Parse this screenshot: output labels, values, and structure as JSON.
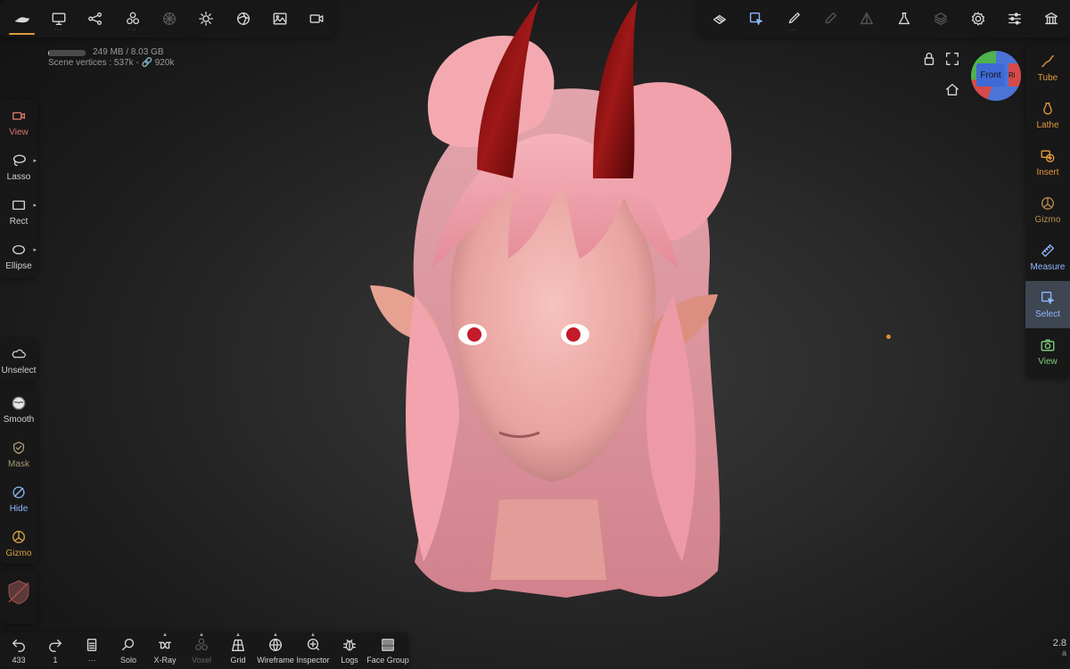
{
  "top_left_toolbar": {
    "items": [
      {
        "name": "nomad-menu-icon",
        "active": true
      },
      {
        "name": "display-icon",
        "dots": "···"
      },
      {
        "name": "scene-graph-icon"
      },
      {
        "name": "primitives-icon",
        "dots": "···"
      },
      {
        "name": "topology-icon",
        "disabled": true
      },
      {
        "name": "lighting-icon"
      },
      {
        "name": "material-icon"
      },
      {
        "name": "background-image-icon"
      },
      {
        "name": "camera-icon"
      }
    ]
  },
  "top_right_toolbar": {
    "items": [
      {
        "name": "paint-layers-icon"
      },
      {
        "name": "select-tool-icon",
        "highlight": true
      },
      {
        "name": "brush-icon",
        "dots": "···"
      },
      {
        "name": "pen-icon",
        "disabled": true
      },
      {
        "name": "symmetry-icon",
        "disabled": true
      },
      {
        "name": "flask-icon"
      },
      {
        "name": "layers-icon",
        "disabled": true
      },
      {
        "name": "settings-icon"
      },
      {
        "name": "sliders-icon"
      },
      {
        "name": "museum-icon"
      }
    ]
  },
  "stats": {
    "memory": "249 MB / 8.03 GB",
    "memory_fraction": 0.03,
    "scene_vertices": "Scene vertices : 537k - 🔗 920k"
  },
  "left_tools_top": [
    {
      "label": "View",
      "icon": "video-camera-icon",
      "color": "#d9786a"
    },
    {
      "label": "Lasso",
      "icon": "lasso-icon",
      "arrow": "▸"
    },
    {
      "label": "Rect",
      "icon": "rect-icon",
      "arrow": "▸"
    },
    {
      "label": "Ellipse",
      "icon": "ellipse-icon",
      "arrow": "▸"
    }
  ],
  "left_tools_bottom": [
    {
      "label": "Unselect",
      "icon": "cloud-icon"
    },
    {
      "label": "Smooth",
      "icon": "smooth-icon"
    },
    {
      "label": "Mask",
      "icon": "mask-icon",
      "color": "#a89a73"
    },
    {
      "label": "Hide",
      "icon": "hide-icon",
      "color": "#8fb9ff"
    },
    {
      "label": "Gizmo",
      "icon": "gizmo-icon",
      "color": "#d4a244"
    }
  ],
  "right_tools": [
    {
      "label": "Tube",
      "icon": "tube-icon",
      "color": "#e39a3b"
    },
    {
      "label": "Lathe",
      "icon": "lathe-icon",
      "color": "#e39a3b"
    },
    {
      "label": "Insert",
      "icon": "insert-icon",
      "color": "#e39a3b"
    },
    {
      "label": "Gizmo",
      "icon": "gizmo-icon",
      "color": "#b98c49"
    },
    {
      "label": "Measure",
      "icon": "ruler-icon",
      "color": "#8fb9ff"
    },
    {
      "label": "Select",
      "icon": "select-icon",
      "color": "#8fb9ff",
      "selected": true
    },
    {
      "label": "View",
      "icon": "camera-icon",
      "color": "#7dd17d"
    }
  ],
  "bottom_toolbar": [
    {
      "label": "433",
      "icon": "undo-icon"
    },
    {
      "label": "1",
      "icon": "redo-icon"
    },
    {
      "label": "···",
      "icon": "document-icon"
    },
    {
      "label": "Solo",
      "icon": "search-icon"
    },
    {
      "label": "X-Ray",
      "icon": "xray-icon",
      "caret": true
    },
    {
      "label": "Voxel",
      "icon": "voxel-icon",
      "dim": true,
      "caret": true
    },
    {
      "label": "Grid",
      "icon": "grid-icon",
      "caret": true
    },
    {
      "label": "Wireframe",
      "icon": "wireframe-icon",
      "caret": true
    },
    {
      "label": "Inspector",
      "icon": "inspector-icon",
      "caret": true
    },
    {
      "label": "Logs",
      "icon": "bug-icon"
    },
    {
      "label": "Face Group",
      "icon": "face-group-icon"
    }
  ],
  "view_cube": {
    "front_label": "Front",
    "right_label": "Ri"
  },
  "frame_rate": "2.8",
  "frame_rate_suffix": "a",
  "colors": {
    "accent": "#e39a3b",
    "blue": "#8fb9ff",
    "skin": "#f2b4b4",
    "hair": "#f2a6ad",
    "horn": "#7a1010"
  }
}
